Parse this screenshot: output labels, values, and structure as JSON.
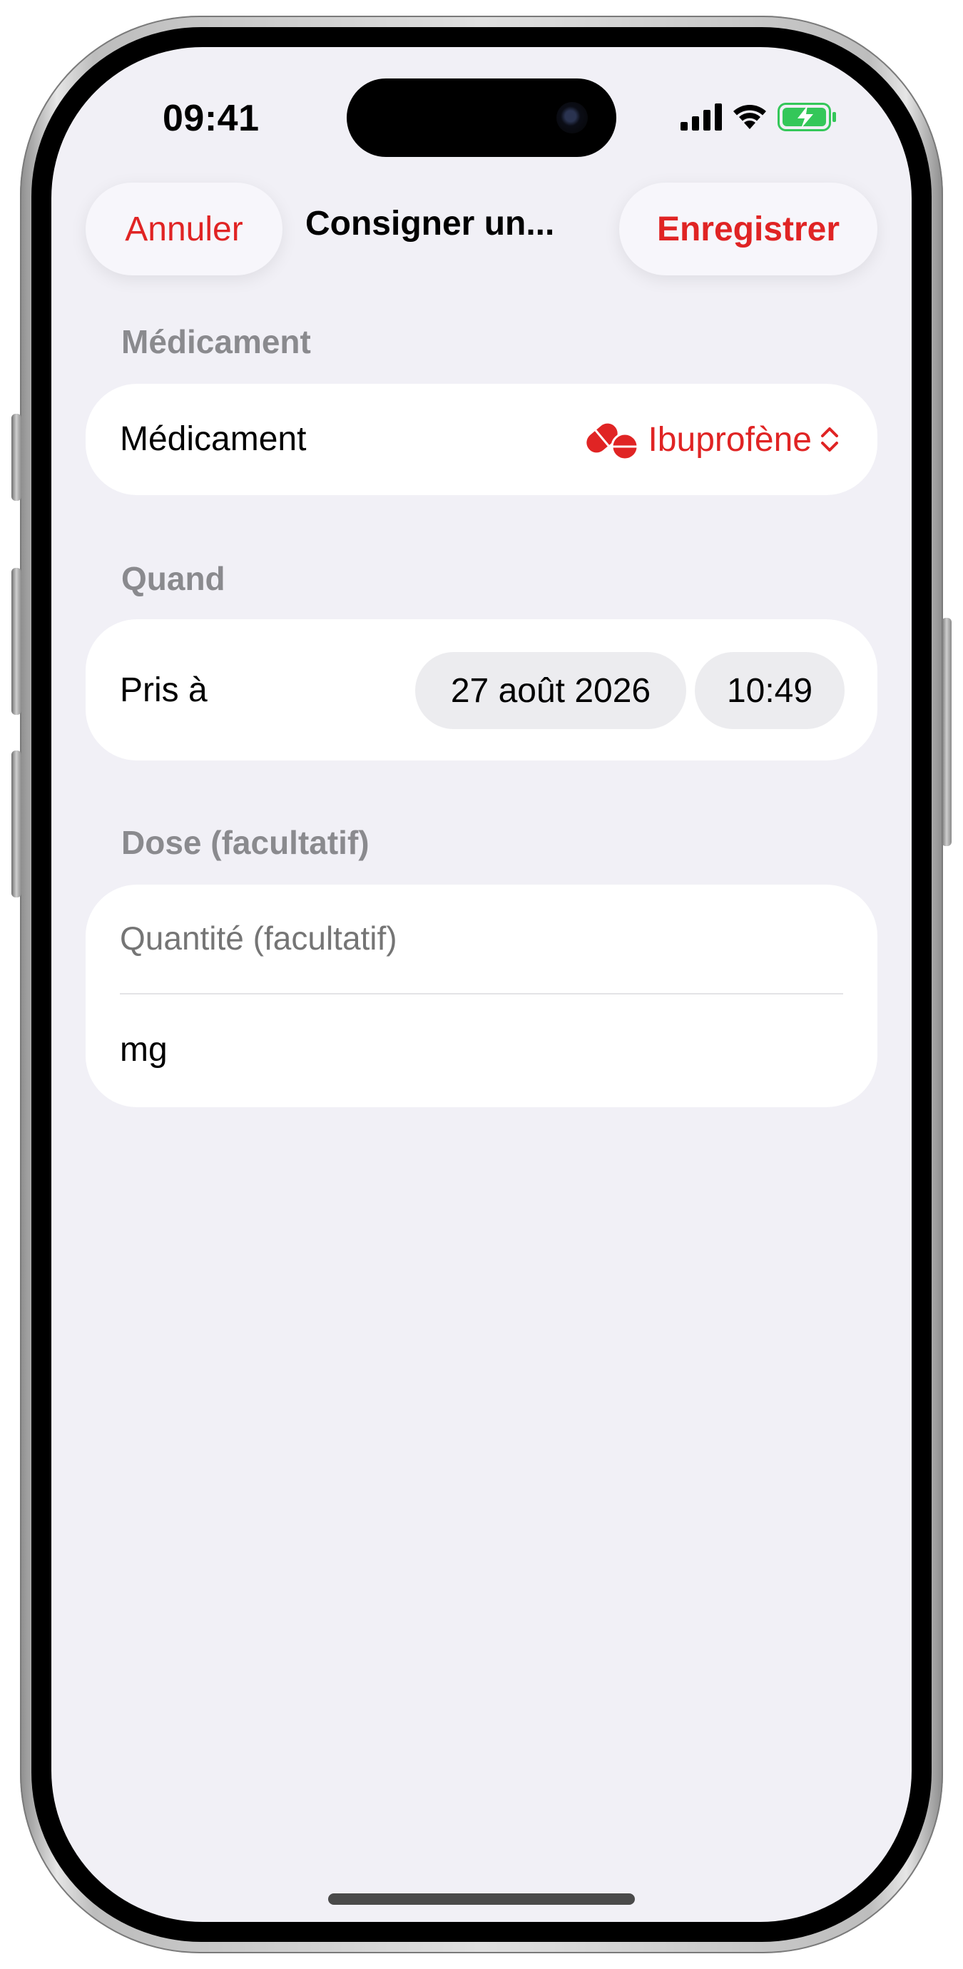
{
  "status_bar": {
    "time": "09:41",
    "signal_icon": "cellular-signal-icon",
    "wifi_icon": "wifi-icon",
    "battery_icon": "battery-charging-icon",
    "battery_color": "#34c759"
  },
  "nav": {
    "cancel_label": "Annuler",
    "title": "Consigner un...",
    "save_label": "Enregistrer",
    "accent_color": "#e02424"
  },
  "medication_section": {
    "header": "Médicament",
    "row_label": "Médicament",
    "selected_value": "Ibuprofène",
    "value_icon": "pills-icon",
    "chevron_icon": "chevron-up-down-icon"
  },
  "when_section": {
    "header": "Quand",
    "row_label": "Pris à",
    "date": "27 août 2026",
    "time": "10:49"
  },
  "dose_section": {
    "header": "Dose (facultatif)",
    "quantity_placeholder": "Quantité (facultatif)",
    "quantity_value": "",
    "unit": "mg"
  }
}
